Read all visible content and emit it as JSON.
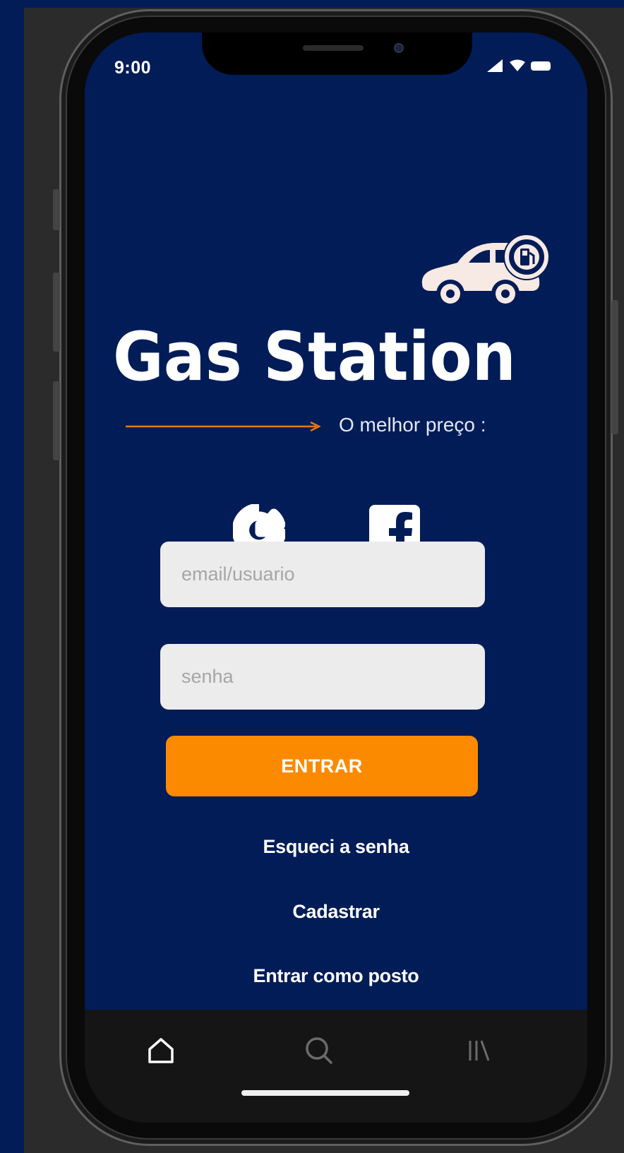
{
  "status_bar": {
    "time": "9:00",
    "icons": [
      "signal-icon",
      "wifi-icon",
      "battery-icon"
    ]
  },
  "brand": {
    "title": "Gas Station",
    "tagline": "O melhor preço :",
    "logo_icon": "car-fuel-icon",
    "arrow_color": "#e07b17"
  },
  "social": {
    "google_icon": "google-icon",
    "facebook_icon": "facebook-icon"
  },
  "form": {
    "email_placeholder": "email/usuario",
    "email_value": "",
    "password_placeholder": "senha",
    "password_value": "",
    "submit_label": "ENTRAR"
  },
  "links": {
    "forgot_password": "Esqueci a senha",
    "register": "Cadastrar",
    "login_as_station": "Entrar como posto"
  },
  "tabbar": {
    "tabs": [
      {
        "icon": "home-icon"
      },
      {
        "icon": "search-icon"
      },
      {
        "icon": "library-icon"
      }
    ]
  },
  "colors": {
    "background": "#011c57",
    "accent": "#fb8a00",
    "input_bg": "#ececec",
    "tabbar_bg": "#151515"
  }
}
